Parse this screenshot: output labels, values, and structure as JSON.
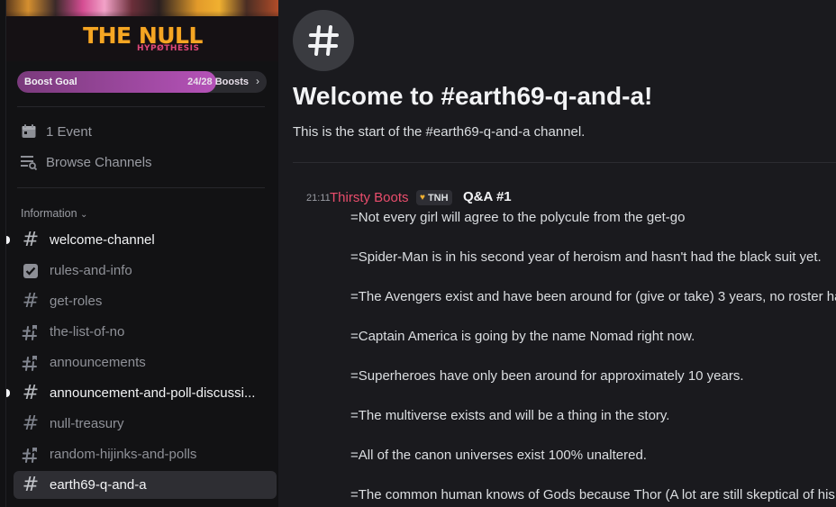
{
  "server": {
    "banner_title": "THE NULL",
    "banner_subtitle": "HYPØTHESIS",
    "boost_goal": {
      "label": "Boost Goal",
      "count_text": "24/28 Boosts",
      "current": 24,
      "target": 28
    }
  },
  "sidebar": {
    "events": {
      "label": "1 Event",
      "icon": "calendar-icon"
    },
    "browse": {
      "label": "Browse Channels",
      "icon": "browse-channels-icon"
    },
    "category": "Information",
    "channels": [
      {
        "name": "welcome-channel",
        "icon": "hash",
        "unread": true,
        "active": false
      },
      {
        "name": "rules-and-info",
        "icon": "rules-check",
        "unread": false,
        "active": false
      },
      {
        "name": "get-roles",
        "icon": "hash",
        "unread": false,
        "active": false
      },
      {
        "name": "the-list-of-no",
        "icon": "hash-announcement",
        "unread": false,
        "active": false
      },
      {
        "name": "announcements",
        "icon": "hash-announcement",
        "unread": false,
        "active": false
      },
      {
        "name": "announcement-and-poll-discussi...",
        "icon": "hash",
        "unread": true,
        "active": false
      },
      {
        "name": "null-treasury",
        "icon": "hash",
        "unread": false,
        "active": false
      },
      {
        "name": "random-hijinks-and-polls",
        "icon": "hash-announcement",
        "unread": false,
        "active": false
      },
      {
        "name": "earth69-q-and-a",
        "icon": "hash",
        "unread": false,
        "active": true
      }
    ]
  },
  "main": {
    "welcome_title": "Welcome to #earth69-q-and-a!",
    "welcome_subtitle": "This is the start of the #earth69-q-and-a channel.",
    "message": {
      "time": "21:11",
      "author": "Thirsty Boots",
      "tag": "TNH",
      "heading": "Q&A #1",
      "lines": [
        "=Not every girl will agree to the polycule from the get-go",
        "=Spider-Man is in his second year of heroism and hasn't had the black suit yet.",
        "=The Avengers exist and have been around for (give or take) 3 years, no roster ha",
        "=Captain America is going by the name Nomad right now.",
        "=Superheroes have only been around for approximately 10 years.",
        "=The multiverse exists and will be a thing in the story.",
        "=All of the canon universes exist 100% unaltered.",
        "=The common human knows of Gods because Thor (A lot are still skeptical of his"
      ]
    }
  },
  "colors": {
    "author": "#e94d6c",
    "boost_fill": "#b552b8",
    "banner_title": "#f5a623",
    "active_channel_bg": "#2e2e33"
  }
}
